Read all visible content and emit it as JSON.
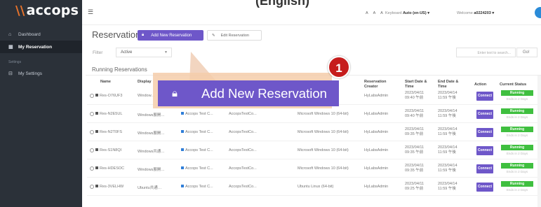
{
  "top_title": "(English)",
  "app": {
    "logo_mark": "\\\\",
    "logo_text": "accops"
  },
  "sidebar": {
    "items": [
      {
        "icon": "dashboard-icon",
        "label": "Dashboard"
      },
      {
        "icon": "reservation-icon",
        "label": "My Reservation"
      }
    ],
    "section": "Settings",
    "settings_item": {
      "icon": "settings-icon",
      "label": "My Settings"
    }
  },
  "topbar": {
    "font_sizes": "A A A",
    "keyboard_label": "Keyboard",
    "keyboard_value": "Auto (en-US) ▾",
    "welcome_label": "Welcome",
    "welcome_user": "a0224203 ▾"
  },
  "page": {
    "title": "Reservation",
    "new_button": "Add New Reservation",
    "edit_button": "Edit Reservation",
    "filter_label": "Filter",
    "filter_value": "Active",
    "search_placeholder": "Enter text to search...",
    "go_button": "Go!",
    "section_title": "Running Reservations"
  },
  "table": {
    "columns": [
      "Name",
      "Display",
      "Reservation Creator",
      "Start Date & Time",
      "End Date & Time",
      "Action",
      "Current Status"
    ],
    "rows": [
      {
        "name": "Res-O76UF3",
        "display": "Window…",
        "template": "",
        "group": "",
        "os": "",
        "creator": "HyLabsAdmin",
        "start1": "2023/04/11",
        "start2": "09:40 午前",
        "end1": "2023/04/14",
        "end2": "11:59 午後",
        "action": "Connect",
        "status": "Running",
        "status_sub": "Ends in 2 Days"
      },
      {
        "name": "Res-N2E5UL",
        "display": "Windows展開…",
        "template": "Accops Test C...",
        "group": "AccopsTestCo...",
        "os": "Microsoft Windows 10 (64-bit)",
        "creator": "HyLabsAdmin",
        "start1": "2023/04/11",
        "start2": "09:40 午前",
        "end1": "2023/04/14",
        "end2": "11:59 午後",
        "action": "Connect",
        "status": "Running",
        "status_sub": "Ends in 2 Days"
      },
      {
        "name": "Res-N2T0FS",
        "display": "Windows展開…",
        "template": "Accops Test C...",
        "group": "AccopsTestCo...",
        "os": "Microsoft Windows 10 (64-bit)",
        "creator": "HyLabsAdmin",
        "start1": "2023/04/11",
        "start2": "09:35 午前",
        "end1": "2023/04/14",
        "end2": "11:59 午後",
        "action": "Connect",
        "status": "Running",
        "status_sub": "Ends in 2 Days"
      },
      {
        "name": "Res-S1N8QI",
        "display": "Windows共通…",
        "template": "Accops Test C...",
        "group": "AccopsTestCo...",
        "os": "Microsoft Windows 10 (64-bit)",
        "creator": "HyLabsAdmin",
        "start1": "2023/04/11",
        "start2": "09:35 午前",
        "end1": "2023/04/14",
        "end2": "11:59 午後",
        "action": "Connect",
        "status": "Running",
        "status_sub": "Ends in 2 Days"
      },
      {
        "name": "Res-HDESOC",
        "display": "Windows展開…",
        "template": "Accops Test C...",
        "group": "AccopsTestCo...",
        "os": "Microsoft Windows 10 (64-bit)",
        "creator": "HyLabsAdmin",
        "start1": "2023/04/11",
        "start2": "09:35 午前",
        "end1": "2023/04/14",
        "end2": "11:59 午後",
        "action": "Connect",
        "status": "Running",
        "status_sub": "Ends in 2 Days"
      },
      {
        "name": "Res-3VELHW",
        "display": "Ubuntu共通…",
        "template": "Accops Test C...",
        "group": "AccopsTestCo...",
        "os": "Ubuntu Linux (64-bit)",
        "creator": "HyLabsAdmin",
        "start1": "2023/04/11",
        "start2": "09:25 午前",
        "end1": "2023/04/14",
        "end2": "11:59 午後",
        "action": "Connect",
        "status": "Running",
        "status_sub": "Ends in 2 Days"
      }
    ]
  },
  "callout": {
    "label": "Add New Reservation",
    "step": "1"
  },
  "colors": {
    "accent": "#6e57c9",
    "running": "#3fbf3f",
    "sidebar": "#2b3139",
    "step_badge": "#c61d1d",
    "brand": "#e8732b"
  }
}
